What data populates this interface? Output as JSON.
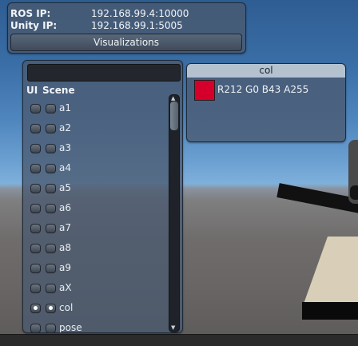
{
  "connection": {
    "ros_label": "ROS IP:",
    "ros_value": "192.168.99.4:10000",
    "unity_label": "Unity IP:",
    "unity_value": "192.168.99.1:5005",
    "visualizations_button": "Visualizations"
  },
  "visualizations": {
    "search_value": "",
    "headers": {
      "ui": "UI",
      "scene": "Scene"
    },
    "items": [
      {
        "label": "a1",
        "ui_on": false,
        "scene_on": false
      },
      {
        "label": "a2",
        "ui_on": false,
        "scene_on": false
      },
      {
        "label": "a3",
        "ui_on": false,
        "scene_on": false
      },
      {
        "label": "a4",
        "ui_on": false,
        "scene_on": false
      },
      {
        "label": "a5",
        "ui_on": false,
        "scene_on": false
      },
      {
        "label": "a6",
        "ui_on": false,
        "scene_on": false
      },
      {
        "label": "a7",
        "ui_on": false,
        "scene_on": false
      },
      {
        "label": "a8",
        "ui_on": false,
        "scene_on": false
      },
      {
        "label": "a9",
        "ui_on": false,
        "scene_on": false
      },
      {
        "label": "aX",
        "ui_on": false,
        "scene_on": false
      },
      {
        "label": "col",
        "ui_on": true,
        "scene_on": true
      },
      {
        "label": "pose",
        "ui_on": false,
        "scene_on": false
      }
    ]
  },
  "color_panel": {
    "title": "col",
    "value_text": "R212 G0 B43 A255",
    "swatch_color": "#d4002b"
  },
  "icons": {
    "scroll_up": "▲",
    "scroll_down": "▼"
  }
}
